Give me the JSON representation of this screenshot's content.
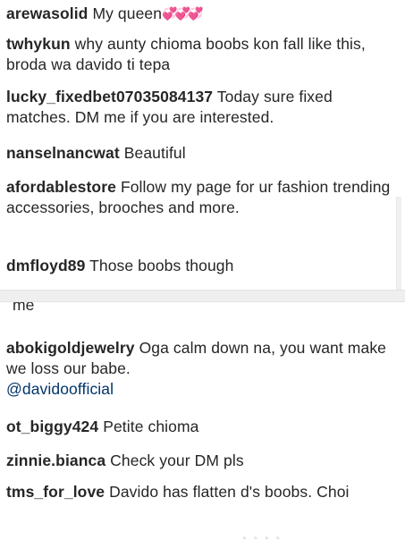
{
  "top_comments": [
    {
      "user": "arewasolid",
      "text": "My queen",
      "emoji": "💞💞💞"
    },
    {
      "user": "twhykun",
      "text": "why aunty chioma boobs kon fall like this, broda wa davido ti tepa"
    },
    {
      "user": "lucky_fixedbet07035084137",
      "text": "Today sure fixed matches. DM me if you are interested."
    },
    {
      "user": "nanselnancwat",
      "text": "Beautiful"
    },
    {
      "user": "afordablestore",
      "text": "Follow my page for ur fashion trending accessories, brooches and more."
    },
    {
      "user": "dmfloyd89",
      "text": "Those boobs though"
    }
  ],
  "bottom_cut_text": "me",
  "bottom_comments": [
    {
      "user": "abokigoldjewelry",
      "text": "Oga calm down na, you want make we loss our babe.",
      "mention": "@davidoofficial"
    },
    {
      "user": "ot_biggy424",
      "text": "Petite chioma"
    },
    {
      "user": "zinnie.bianca",
      "text": "Check your DM pls"
    },
    {
      "user": "tms_for_love",
      "text": "Davido has flatten d's boobs. Choi"
    }
  ]
}
